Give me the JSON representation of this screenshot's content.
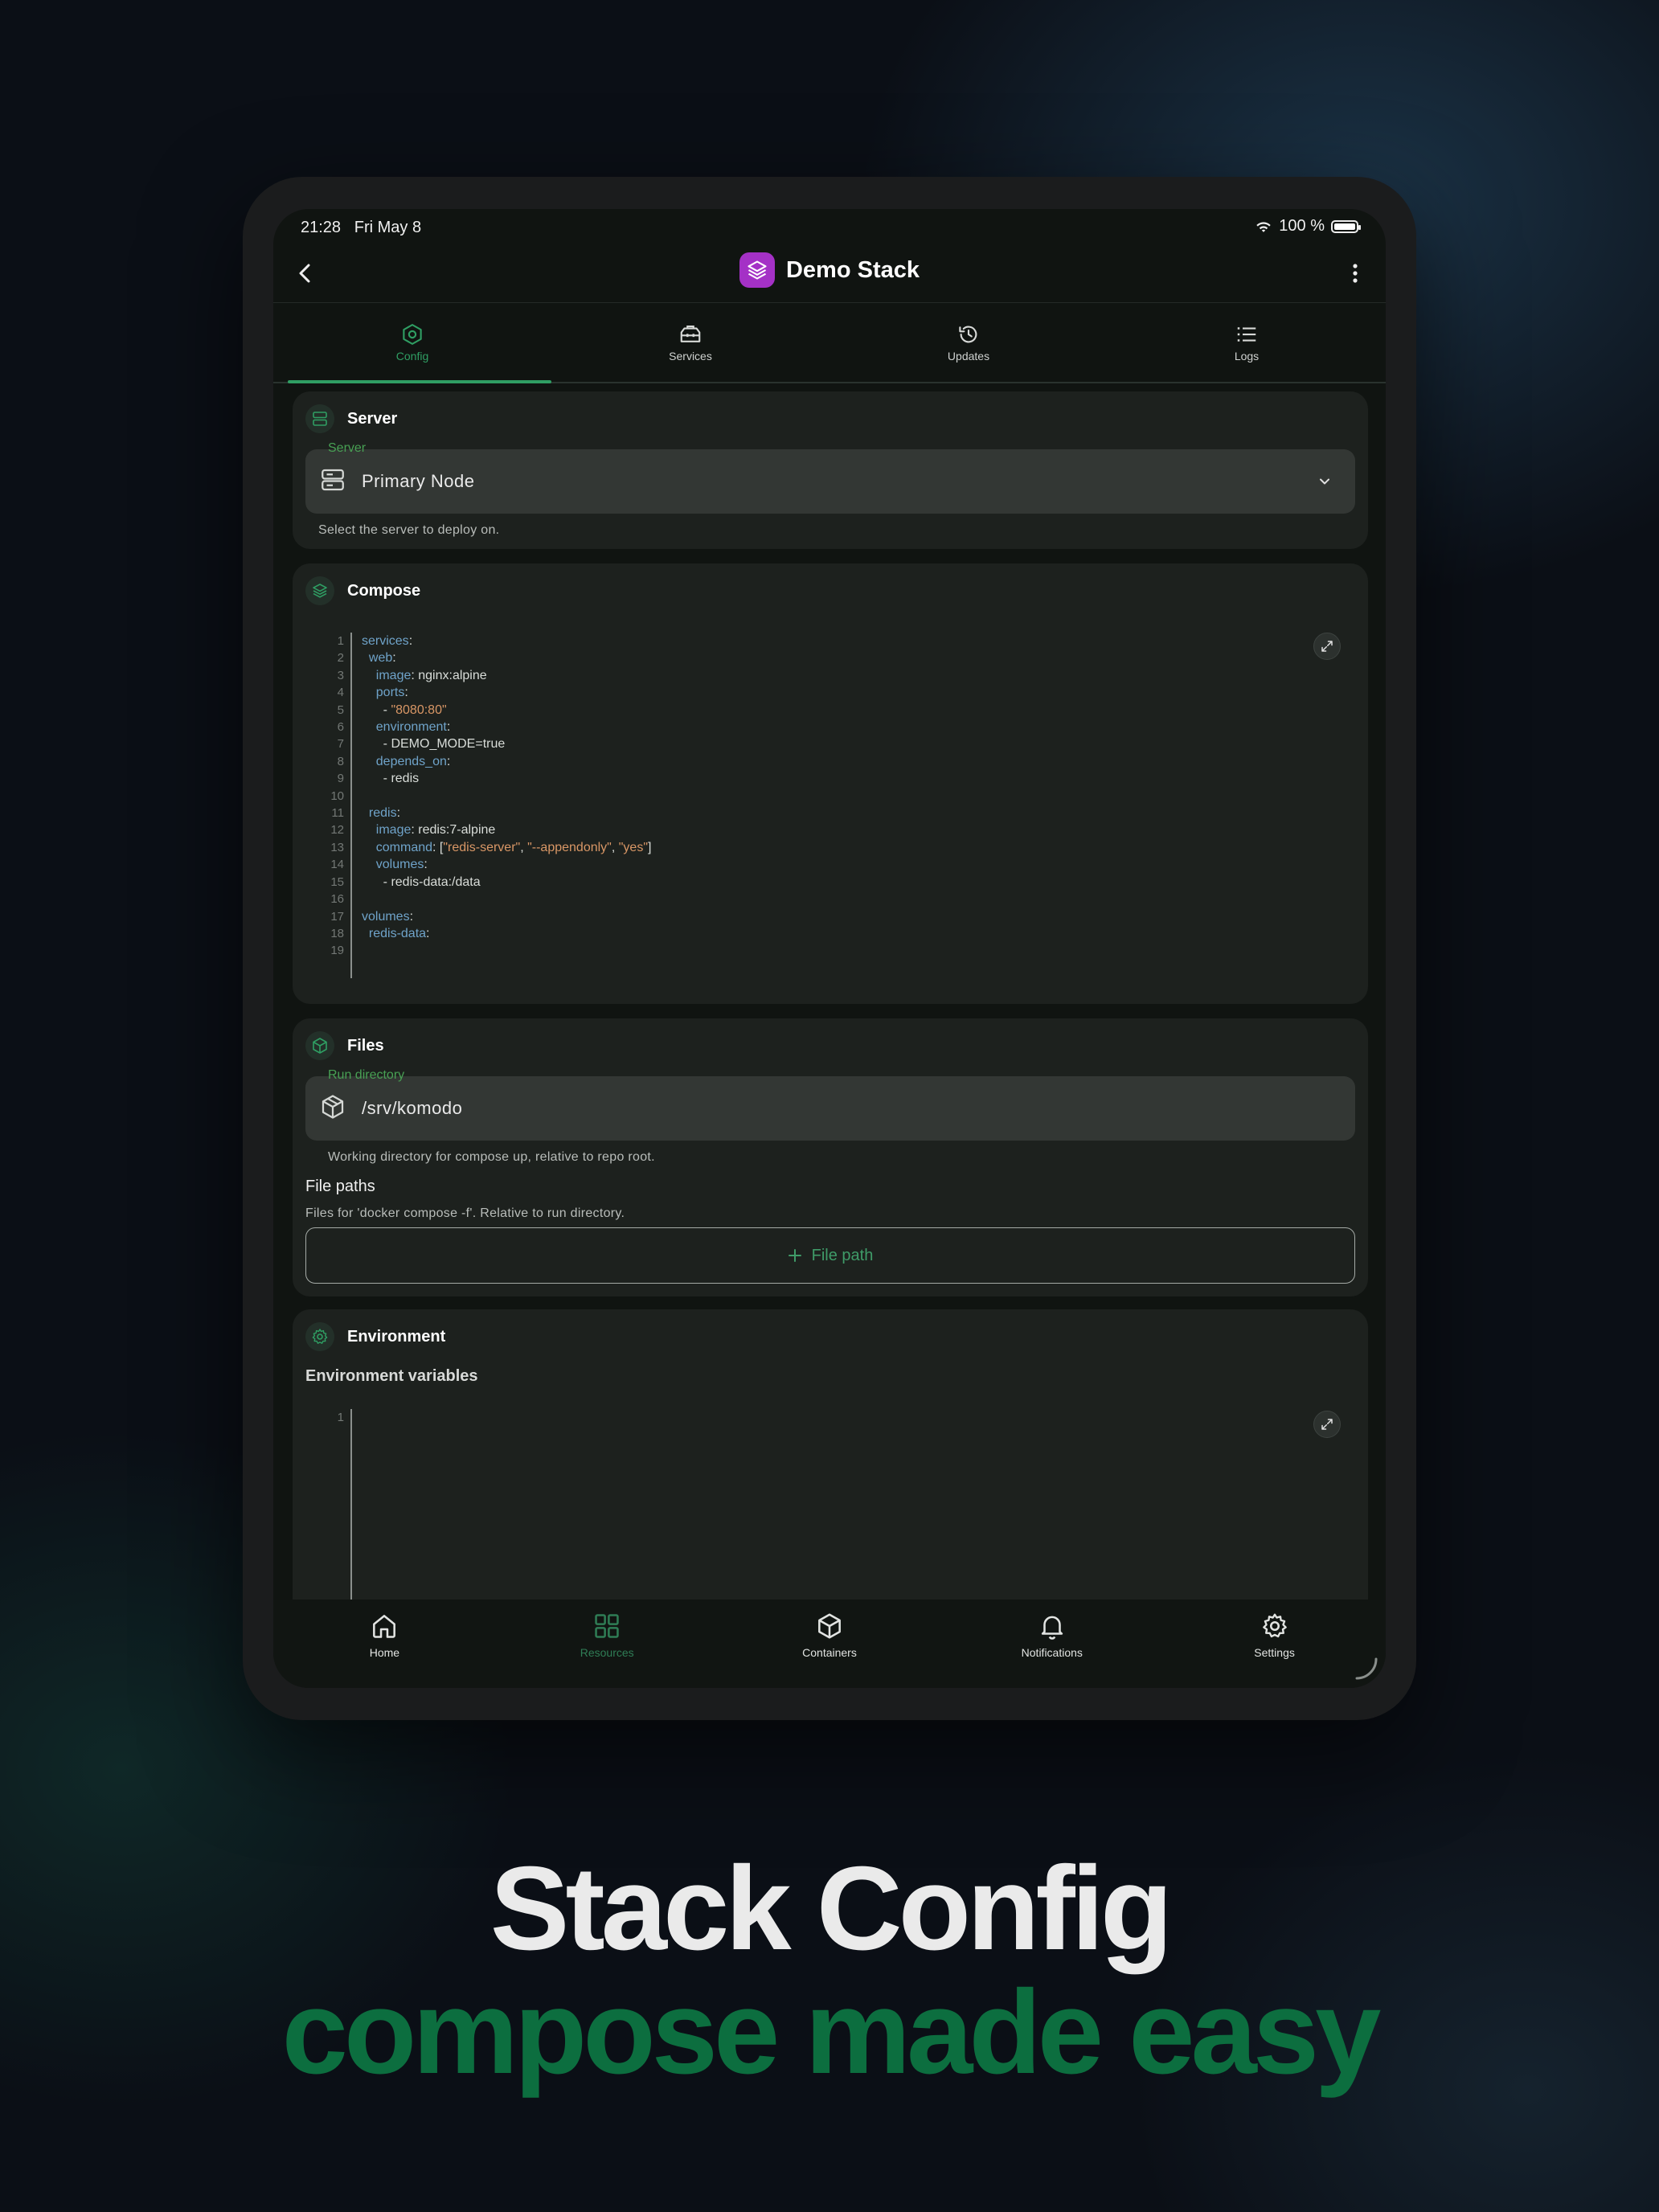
{
  "status_bar": {
    "time": "21:28",
    "date": "Fri May 8",
    "battery": "100 %"
  },
  "header": {
    "title": "Demo Stack"
  },
  "tabs": [
    {
      "label": "Config",
      "icon": "hexagon-icon",
      "active": true
    },
    {
      "label": "Services",
      "icon": "toolbox-icon",
      "active": false
    },
    {
      "label": "Updates",
      "icon": "history-icon",
      "active": false
    },
    {
      "label": "Logs",
      "icon": "list-icon",
      "active": false
    }
  ],
  "server_card": {
    "title": "Server",
    "field_label": "Server",
    "value": "Primary Node",
    "helper": "Select the server to deploy on."
  },
  "compose_card": {
    "title": "Compose",
    "line_numbers": [
      "1",
      "2",
      "3",
      "4",
      "5",
      "6",
      "7",
      "8",
      "9",
      "10",
      "11",
      "12",
      "13",
      "14",
      "15",
      "16",
      "17",
      "18",
      "19"
    ],
    "code": [
      "services:",
      "  web:",
      "    image: nginx:alpine",
      "    ports:",
      "      - \"8080:80\"",
      "    environment:",
      "      - DEMO_MODE=true",
      "    depends_on:",
      "      - redis",
      "",
      "  redis:",
      "    image: redis:7-alpine",
      "    command: [\"redis-server\", \"--appendonly\", \"yes\"]",
      "    volumes:",
      "      - redis-data:/data",
      "",
      "volumes:",
      "  redis-data:",
      ""
    ]
  },
  "files_card": {
    "title": "Files",
    "field_label": "Run directory",
    "value": "/srv/komodo",
    "helper": "Working directory for compose up, relative to repo root.",
    "file_paths_title": "File paths",
    "file_paths_helper": "Files for 'docker compose -f'. Relative to run directory.",
    "add_button": "File path"
  },
  "environment_card": {
    "title": "Environment",
    "subtitle": "Environment variables",
    "line_numbers": [
      "1"
    ]
  },
  "bottom_nav": [
    {
      "label": "Home",
      "icon": "home-icon",
      "active": false
    },
    {
      "label": "Resources",
      "icon": "grid-icon",
      "active": true
    },
    {
      "label": "Containers",
      "icon": "cube-icon",
      "active": false
    },
    {
      "label": "Notifications",
      "icon": "bell-icon",
      "active": false
    },
    {
      "label": "Settings",
      "icon": "gear-icon",
      "active": false
    }
  ],
  "headline": {
    "line1": "Stack Config",
    "line2": "compose made easy"
  },
  "colors": {
    "accent": "#2f9e63",
    "app_icon": "#a431c6",
    "headline_green": "#0c6e3f"
  }
}
